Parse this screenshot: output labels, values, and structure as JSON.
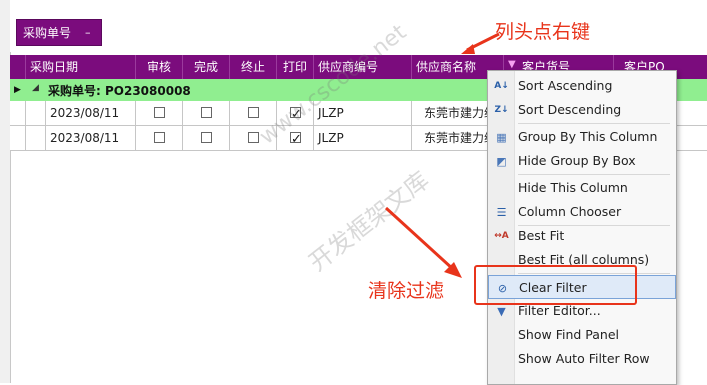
{
  "group_panel": {
    "chip_label": "采购单号",
    "chip_remove": "–"
  },
  "header": {
    "columns": [
      "采购日期",
      "审核",
      "完成",
      "终止",
      "打印",
      "供应商编号",
      "供应商名称",
      "客户货号",
      "客户PO"
    ]
  },
  "group_row": {
    "label": "采购单号: PO23080008"
  },
  "rows": [
    {
      "date": "2023/08/11",
      "approved": false,
      "done": false,
      "stopped": false,
      "printed": true,
      "supplier_code": "JLZP",
      "supplier_name": "东莞市建力纸"
    },
    {
      "date": "2023/08/11",
      "approved": false,
      "done": false,
      "stopped": false,
      "printed": true,
      "supplier_code": "JLZP",
      "supplier_name": "东莞市建力纸"
    }
  ],
  "context_menu": {
    "items": [
      {
        "label": "Sort Ascending",
        "icon": "sort-ascending-icon"
      },
      {
        "label": "Sort Descending",
        "icon": "sort-descending-icon"
      },
      {
        "label": "Group By This Column",
        "icon": "group-by-icon"
      },
      {
        "label": "Hide Group By Box",
        "icon": "hide-group-box-icon"
      },
      {
        "label": "Hide This Column",
        "icon": ""
      },
      {
        "label": "Column Chooser",
        "icon": "column-chooser-icon"
      },
      {
        "label": "Best Fit",
        "icon": "best-fit-icon"
      },
      {
        "label": "Best Fit (all columns)",
        "icon": ""
      },
      {
        "label": "Clear Filter",
        "icon": "clear-filter-icon"
      },
      {
        "label": "Filter Editor...",
        "icon": "filter-editor-icon"
      },
      {
        "label": "Show Find Panel",
        "icon": ""
      },
      {
        "label": "Show Auto Filter Row",
        "icon": ""
      }
    ]
  },
  "annotations": {
    "right_click_note": "列头点右键",
    "clear_filter_note": "清除过滤"
  },
  "watermark": {
    "line1": "www.cscode.net",
    "line2": "开发框架文库"
  },
  "colors": {
    "header_bg": "#7b0c7d",
    "group_row_bg": "#90ee90",
    "annotation_red": "#e8341b",
    "highlight_bg": "#dfeaf8"
  }
}
